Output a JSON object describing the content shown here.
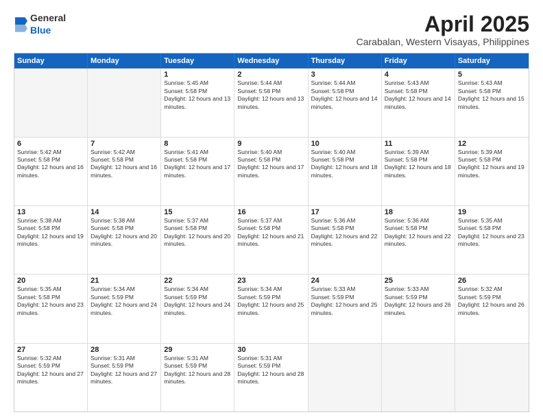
{
  "header": {
    "logo_general": "General",
    "logo_blue": "Blue",
    "title": "April 2025",
    "subtitle": "Carabalan, Western Visayas, Philippines"
  },
  "calendar": {
    "day_names": [
      "Sunday",
      "Monday",
      "Tuesday",
      "Wednesday",
      "Thursday",
      "Friday",
      "Saturday"
    ],
    "weeks": [
      [
        {
          "date": "",
          "sunrise": "",
          "sunset": "",
          "daylight": ""
        },
        {
          "date": "",
          "sunrise": "",
          "sunset": "",
          "daylight": ""
        },
        {
          "date": "1",
          "sunrise": "Sunrise: 5:45 AM",
          "sunset": "Sunset: 5:58 PM",
          "daylight": "Daylight: 12 hours and 13 minutes."
        },
        {
          "date": "2",
          "sunrise": "Sunrise: 5:44 AM",
          "sunset": "Sunset: 5:58 PM",
          "daylight": "Daylight: 12 hours and 13 minutes."
        },
        {
          "date": "3",
          "sunrise": "Sunrise: 5:44 AM",
          "sunset": "Sunset: 5:58 PM",
          "daylight": "Daylight: 12 hours and 14 minutes."
        },
        {
          "date": "4",
          "sunrise": "Sunrise: 5:43 AM",
          "sunset": "Sunset: 5:58 PM",
          "daylight": "Daylight: 12 hours and 14 minutes."
        },
        {
          "date": "5",
          "sunrise": "Sunrise: 5:43 AM",
          "sunset": "Sunset: 5:58 PM",
          "daylight": "Daylight: 12 hours and 15 minutes."
        }
      ],
      [
        {
          "date": "6",
          "sunrise": "Sunrise: 5:42 AM",
          "sunset": "Sunset: 5:58 PM",
          "daylight": "Daylight: 12 hours and 16 minutes."
        },
        {
          "date": "7",
          "sunrise": "Sunrise: 5:42 AM",
          "sunset": "Sunset: 5:58 PM",
          "daylight": "Daylight: 12 hours and 16 minutes."
        },
        {
          "date": "8",
          "sunrise": "Sunrise: 5:41 AM",
          "sunset": "Sunset: 5:58 PM",
          "daylight": "Daylight: 12 hours and 17 minutes."
        },
        {
          "date": "9",
          "sunrise": "Sunrise: 5:40 AM",
          "sunset": "Sunset: 5:58 PM",
          "daylight": "Daylight: 12 hours and 17 minutes."
        },
        {
          "date": "10",
          "sunrise": "Sunrise: 5:40 AM",
          "sunset": "Sunset: 5:58 PM",
          "daylight": "Daylight: 12 hours and 18 minutes."
        },
        {
          "date": "11",
          "sunrise": "Sunrise: 5:39 AM",
          "sunset": "Sunset: 5:58 PM",
          "daylight": "Daylight: 12 hours and 18 minutes."
        },
        {
          "date": "12",
          "sunrise": "Sunrise: 5:39 AM",
          "sunset": "Sunset: 5:58 PM",
          "daylight": "Daylight: 12 hours and 19 minutes."
        }
      ],
      [
        {
          "date": "13",
          "sunrise": "Sunrise: 5:38 AM",
          "sunset": "Sunset: 5:58 PM",
          "daylight": "Daylight: 12 hours and 19 minutes."
        },
        {
          "date": "14",
          "sunrise": "Sunrise: 5:38 AM",
          "sunset": "Sunset: 5:58 PM",
          "daylight": "Daylight: 12 hours and 20 minutes."
        },
        {
          "date": "15",
          "sunrise": "Sunrise: 5:37 AM",
          "sunset": "Sunset: 5:58 PM",
          "daylight": "Daylight: 12 hours and 20 minutes."
        },
        {
          "date": "16",
          "sunrise": "Sunrise: 5:37 AM",
          "sunset": "Sunset: 5:58 PM",
          "daylight": "Daylight: 12 hours and 21 minutes."
        },
        {
          "date": "17",
          "sunrise": "Sunrise: 5:36 AM",
          "sunset": "Sunset: 5:58 PM",
          "daylight": "Daylight: 12 hours and 22 minutes."
        },
        {
          "date": "18",
          "sunrise": "Sunrise: 5:36 AM",
          "sunset": "Sunset: 5:58 PM",
          "daylight": "Daylight: 12 hours and 22 minutes."
        },
        {
          "date": "19",
          "sunrise": "Sunrise: 5:35 AM",
          "sunset": "Sunset: 5:58 PM",
          "daylight": "Daylight: 12 hours and 23 minutes."
        }
      ],
      [
        {
          "date": "20",
          "sunrise": "Sunrise: 5:35 AM",
          "sunset": "Sunset: 5:58 PM",
          "daylight": "Daylight: 12 hours and 23 minutes."
        },
        {
          "date": "21",
          "sunrise": "Sunrise: 5:34 AM",
          "sunset": "Sunset: 5:59 PM",
          "daylight": "Daylight: 12 hours and 24 minutes."
        },
        {
          "date": "22",
          "sunrise": "Sunrise: 5:34 AM",
          "sunset": "Sunset: 5:59 PM",
          "daylight": "Daylight: 12 hours and 24 minutes."
        },
        {
          "date": "23",
          "sunrise": "Sunrise: 5:34 AM",
          "sunset": "Sunset: 5:59 PM",
          "daylight": "Daylight: 12 hours and 25 minutes."
        },
        {
          "date": "24",
          "sunrise": "Sunrise: 5:33 AM",
          "sunset": "Sunset: 5:59 PM",
          "daylight": "Daylight: 12 hours and 25 minutes."
        },
        {
          "date": "25",
          "sunrise": "Sunrise: 5:33 AM",
          "sunset": "Sunset: 5:59 PM",
          "daylight": "Daylight: 12 hours and 26 minutes."
        },
        {
          "date": "26",
          "sunrise": "Sunrise: 5:32 AM",
          "sunset": "Sunset: 5:59 PM",
          "daylight": "Daylight: 12 hours and 26 minutes."
        }
      ],
      [
        {
          "date": "27",
          "sunrise": "Sunrise: 5:32 AM",
          "sunset": "Sunset: 5:59 PM",
          "daylight": "Daylight: 12 hours and 27 minutes."
        },
        {
          "date": "28",
          "sunrise": "Sunrise: 5:31 AM",
          "sunset": "Sunset: 5:59 PM",
          "daylight": "Daylight: 12 hours and 27 minutes."
        },
        {
          "date": "29",
          "sunrise": "Sunrise: 5:31 AM",
          "sunset": "Sunset: 5:59 PM",
          "daylight": "Daylight: 12 hours and 28 minutes."
        },
        {
          "date": "30",
          "sunrise": "Sunrise: 5:31 AM",
          "sunset": "Sunset: 5:59 PM",
          "daylight": "Daylight: 12 hours and 28 minutes."
        },
        {
          "date": "",
          "sunrise": "",
          "sunset": "",
          "daylight": ""
        },
        {
          "date": "",
          "sunrise": "",
          "sunset": "",
          "daylight": ""
        },
        {
          "date": "",
          "sunrise": "",
          "sunset": "",
          "daylight": ""
        }
      ]
    ]
  }
}
